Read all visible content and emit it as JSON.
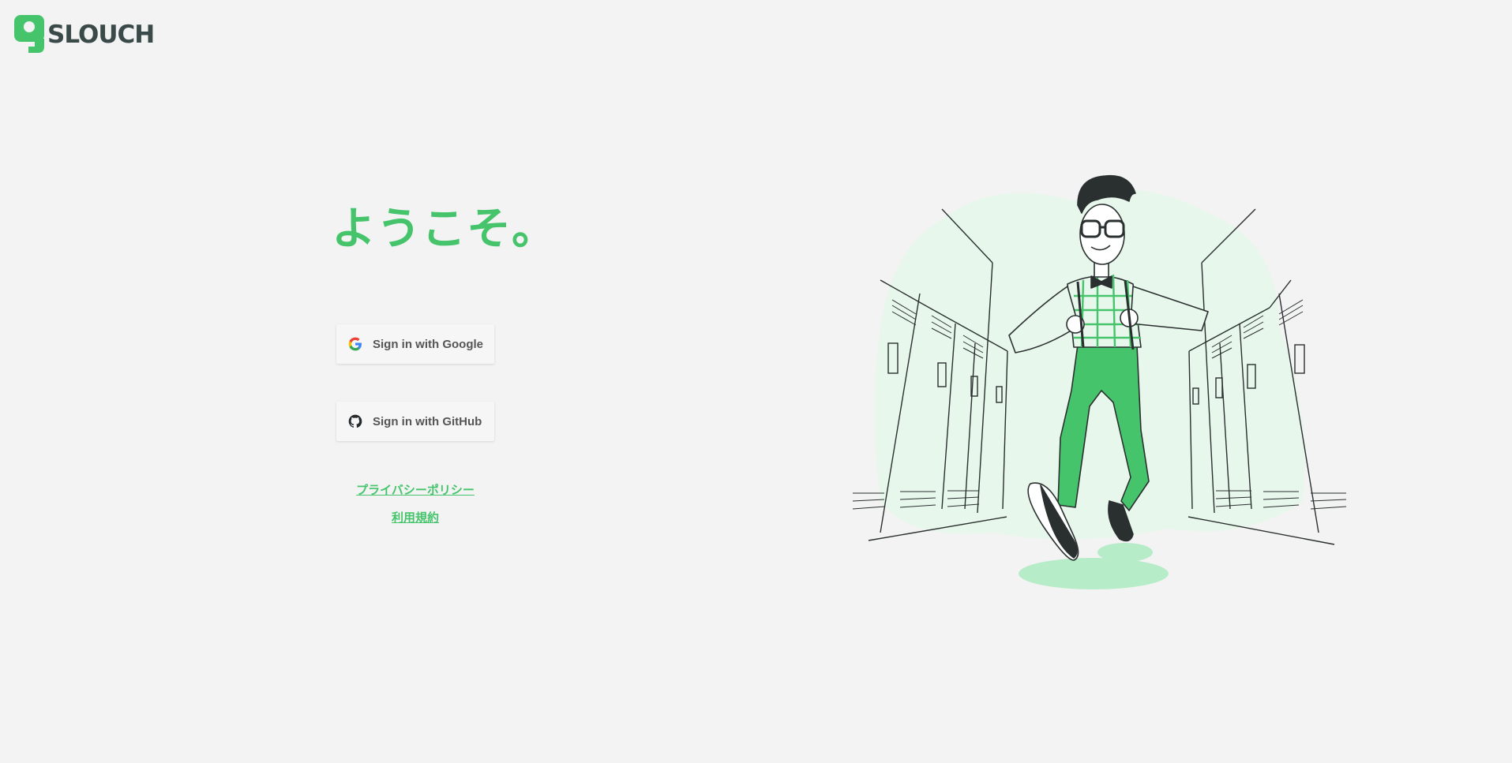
{
  "brand": {
    "name": "SLOUCH",
    "logo_icon": "slouch-logo-icon",
    "accent": "#46c46c",
    "text_dark": "#3a4a49"
  },
  "welcome": {
    "heading": "ようこそ。"
  },
  "auth": {
    "google": {
      "label": "Sign in with Google",
      "icon": "google-icon"
    },
    "github": {
      "label": "Sign in with GitHub",
      "icon": "github-icon"
    }
  },
  "links": {
    "privacy": "プライバシーポリシー",
    "terms": "利用規約"
  },
  "illustration": {
    "subject": "character-in-locker-hallway"
  },
  "colors": {
    "background": "#f3f3f3",
    "green": "#46c46c",
    "light_green": "#b6ecc8",
    "pale_green": "#e8f7ec"
  }
}
